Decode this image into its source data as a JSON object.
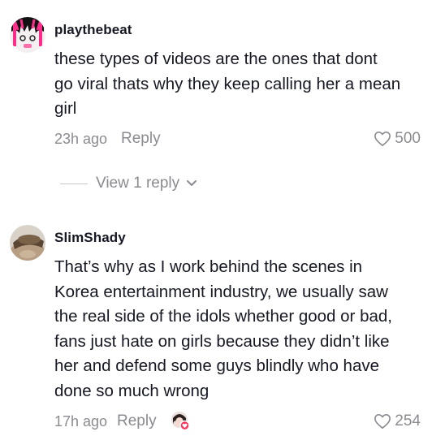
{
  "comments": [
    {
      "username": "playthebeat",
      "lines": [
        "these types of videos are the ones that dont",
        "go viral thats why they keep calling her a mean",
        "girl"
      ],
      "timestamp": "23h ago",
      "reply_label": "Reply",
      "likes": "500",
      "view_replies_label": "View 1 reply"
    },
    {
      "username": "SlimShady",
      "lines": [
        "That’s why as I work behind the scenes in",
        "Korea entertainment industry, we usually saw",
        "the real side of the idols whether good or bad,",
        "fans just hate on girls because they didn’t like",
        "her and defend some guys blindly who have",
        "done so much wrong"
      ],
      "timestamp": "17h ago",
      "reply_label": "Reply",
      "likes": "254"
    }
  ],
  "icons": {
    "like": "heart-outline-icon",
    "expand": "chevron-down-icon",
    "creator_liked": "creator-liked-badge-icon"
  },
  "colors": {
    "text_primary": "#161823",
    "text_secondary": "#8a8b91",
    "heart_badge": "#fe2c55"
  }
}
